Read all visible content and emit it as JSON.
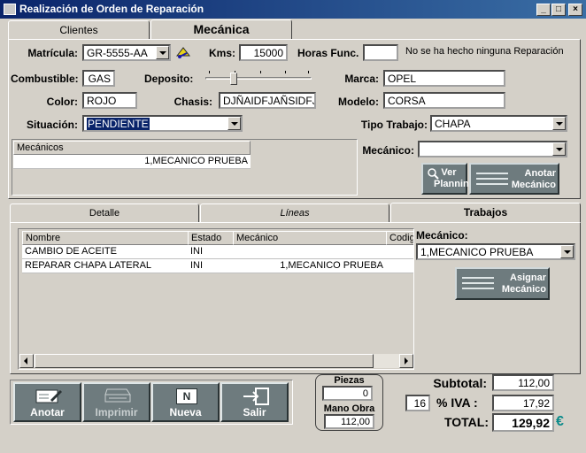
{
  "window": {
    "title": "Realización de Orden de Reparación"
  },
  "top_tabs": [
    "Clientes",
    "Mecánica"
  ],
  "form": {
    "matricula_label": "Matrícula:",
    "matricula_value": "GR-5555-AA",
    "kms_label": "Kms:",
    "kms_value": "15000",
    "horas_label": "Horas Func.",
    "horas_value": "",
    "repair_status": "No se ha hecho ninguna Reparación",
    "combustible_label": "Combustible:",
    "combustible_value": "GAS",
    "deposito_label": "Deposito:",
    "deposito_level": 0.25,
    "marca_label": "Marca:",
    "marca_value": "OPEL",
    "color_label": "Color:",
    "color_value": "ROJO",
    "chasis_label": "Chasis:",
    "chasis_value": "DJÑAIDFJAÑSIDFJ",
    "modelo_label": "Modelo:",
    "modelo_value": "CORSA",
    "situacion_label": "Situación:",
    "situacion_value": "PENDIENTE",
    "tipo_trabajo_label": "Tipo Trabajo:",
    "tipo_trabajo_value": "CHAPA",
    "mecanico_label": "Mecánico:",
    "mecanico_value": ""
  },
  "mecanicos_list": {
    "header": "Mecánicos",
    "rows": [
      "1,MECANICO PRUEBA"
    ]
  },
  "buttons": {
    "ver_planning": "Ver Planning",
    "anotar_mecanico": "Anotar Mecánico",
    "asignar_mecanico": "Asignar Mecánico"
  },
  "bottom_tabs": [
    "Detalle",
    "Líneas",
    "Trabajos"
  ],
  "trabajos_grid": {
    "columns": [
      "Nombre",
      "Estado",
      "Mecánico",
      "Codig"
    ],
    "rows": [
      [
        "CAMBIO DE ACEITE",
        "INI",
        "",
        ""
      ],
      [
        "REPARAR CHAPA LATERAL",
        "INI",
        "1,MECANICO PRUEBA",
        ""
      ]
    ]
  },
  "trabajos_side": {
    "mecanico_label": "Mecánico:",
    "mecanico_value": "1,MECANICO PRUEBA"
  },
  "toolbar": {
    "anotar": "Anotar",
    "imprimir": "Imprimir",
    "nueva": "Nueva",
    "salir": "Salir"
  },
  "totals": {
    "piezas_label": "Piezas",
    "piezas_value": "0",
    "mano_obra_label": "Mano Obra",
    "mano_obra_value": "112,00",
    "subtotal_label": "Subtotal:",
    "subtotal_value": "112,00",
    "iva_rate": "16",
    "iva_label": "% IVA :",
    "iva_value": "17,92",
    "total_label": "TOTAL:",
    "total_value": "129,92",
    "currency": "€"
  },
  "colors": {
    "title_bar": "#0a246a",
    "button_face": "#6e7b7e",
    "selection": "#0a246a",
    "euro": "#0a8a8a"
  }
}
